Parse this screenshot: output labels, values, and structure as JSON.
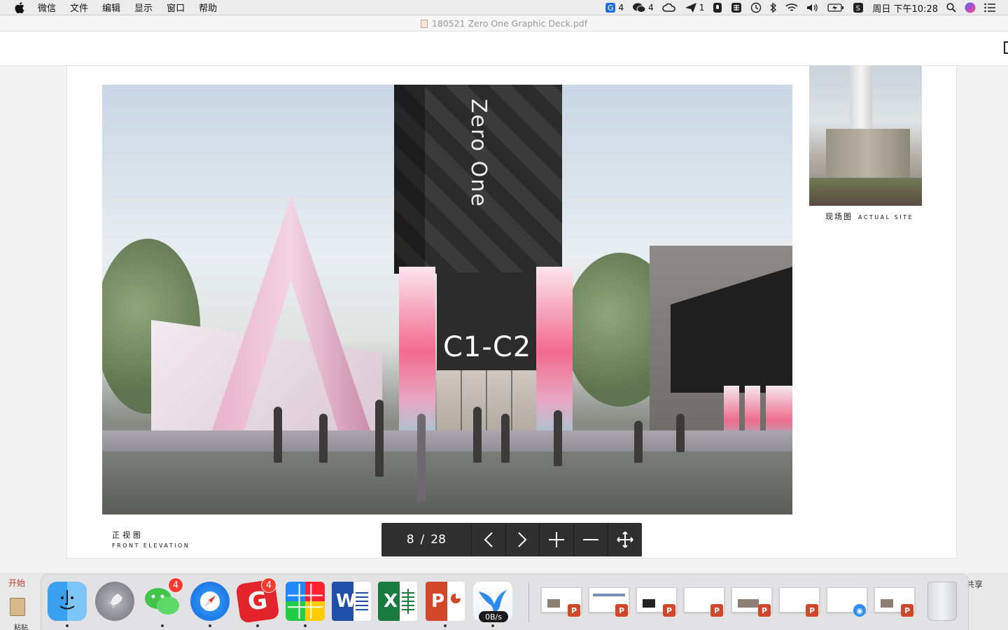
{
  "menubar": {
    "items": [
      "微信",
      "文件",
      "编辑",
      "显示",
      "窗口",
      "帮助"
    ],
    "status": {
      "bandwagon_count": "4",
      "wechat_count": "4",
      "mail_count": "1",
      "datetime": "周日 下午10:28"
    }
  },
  "window": {
    "title": "180521 Zero One Graphic Deck.pdf"
  },
  "document": {
    "render_tower_text": "Zero One",
    "render_gate_text": "C1-C2",
    "caption_left_zh": "正视图",
    "caption_left_en": "FRONT ELEVATION",
    "caption_right_zh": "现场图",
    "caption_right_en": "ACTUAL SITE"
  },
  "pager": {
    "current": "8",
    "separator": "/",
    "total": "28"
  },
  "background_app": {
    "tab_label": "开始",
    "paste_label": "粘贴",
    "share_label": "共享"
  },
  "dock": {
    "wechat_badge": "4",
    "bandwagon_badge": "4",
    "network_speed": "0B/s",
    "apps": [
      {
        "name": "finder-icon"
      },
      {
        "name": "launchpad-icon"
      },
      {
        "name": "wechat-icon"
      },
      {
        "name": "safari-icon"
      },
      {
        "name": "bandwagon-icon"
      },
      {
        "name": "color-grid-icon"
      },
      {
        "name": "word-icon",
        "letter": "W"
      },
      {
        "name": "excel-icon",
        "letter": "X"
      },
      {
        "name": "powerpoint-icon",
        "letter": "P"
      },
      {
        "name": "bird-transfer-icon"
      }
    ]
  },
  "colors": {
    "accent_pink": "#ef6d90",
    "teal": "#7fd5d8",
    "nav_bg": "#303030",
    "badge_red": "#ff3b30"
  }
}
